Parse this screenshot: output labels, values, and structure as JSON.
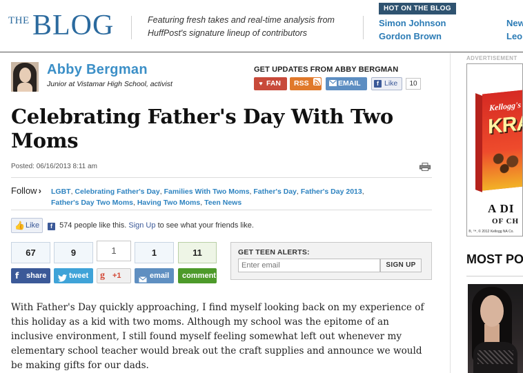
{
  "header": {
    "brand_the": "THE",
    "brand_blog": "BLOG",
    "tagline": "Featuring fresh takes and real-time analysis from HuffPost's signature lineup of contributors",
    "hot_label": "HOT ON THE BLOG",
    "hot_col1": [
      "Simon Johnson",
      "Gordon Brown"
    ],
    "hot_col2": [
      "New",
      "Leo"
    ]
  },
  "author": {
    "name": "Abby Bergman",
    "bio": "Junior at Vistamar High School, activist"
  },
  "updates": {
    "title": "GET UPDATES FROM ABBY BERGMAN",
    "fan_label": "FAN",
    "rss_label": "RSS",
    "email_label": "EMAIL",
    "like_label": "Like",
    "like_count": "10"
  },
  "post": {
    "title": "Celebrating Father's Day With Two Moms",
    "posted": "Posted: 06/16/2013 8:11 am",
    "follow_label": "Follow",
    "tags": [
      "LGBT",
      "Celebrating Father's Day",
      "Families With Two Moms",
      "Father's Day",
      "Father's Day 2013",
      "Father's Day Two Moms",
      "Having Two Moms",
      "Teen News"
    ]
  },
  "facebook": {
    "like_label": "Like",
    "people_text": "574 people like this.",
    "signup_label": "Sign Up",
    "signup_suffix": "to see what your friends like."
  },
  "share": {
    "counts": {
      "facebook": "67",
      "twitter": "9",
      "gplus": "1",
      "email": "1",
      "comment": "11"
    },
    "labels": {
      "facebook": "share",
      "twitter": "tweet",
      "gplus": "+1",
      "email": "email",
      "comment": "comment"
    }
  },
  "alerts": {
    "title": "GET TEEN ALERTS:",
    "placeholder": "Enter email",
    "button": "SIGN UP"
  },
  "article": {
    "paragraph": "With Father's Day quickly approaching, I find myself looking back on my experience of this holiday as a kid with two moms. Although my school was the epitome of an inclusive environment, I still found myself feeling somewhat left out whenever my elementary school teacher would break out the craft supplies and announce we would be making gifts for our dads."
  },
  "sidebar": {
    "ad_label": "ADVERTISEMENT",
    "ad_brand": "Kellogg's",
    "ad_product": "KRA",
    "ad_line1": "A DI",
    "ad_line2": "OF CH",
    "ad_fine": "®, ™, © 2012 Kellogg NA Co.",
    "most_popular": "MOST PO"
  },
  "colors": {
    "brand_blue": "#2b6a9e",
    "link_blue": "#2e83c0",
    "hot_badge": "#2f5370",
    "facebook": "#3b5998",
    "twitter": "#3fa3d8",
    "comment_green": "#4d9a2a"
  }
}
